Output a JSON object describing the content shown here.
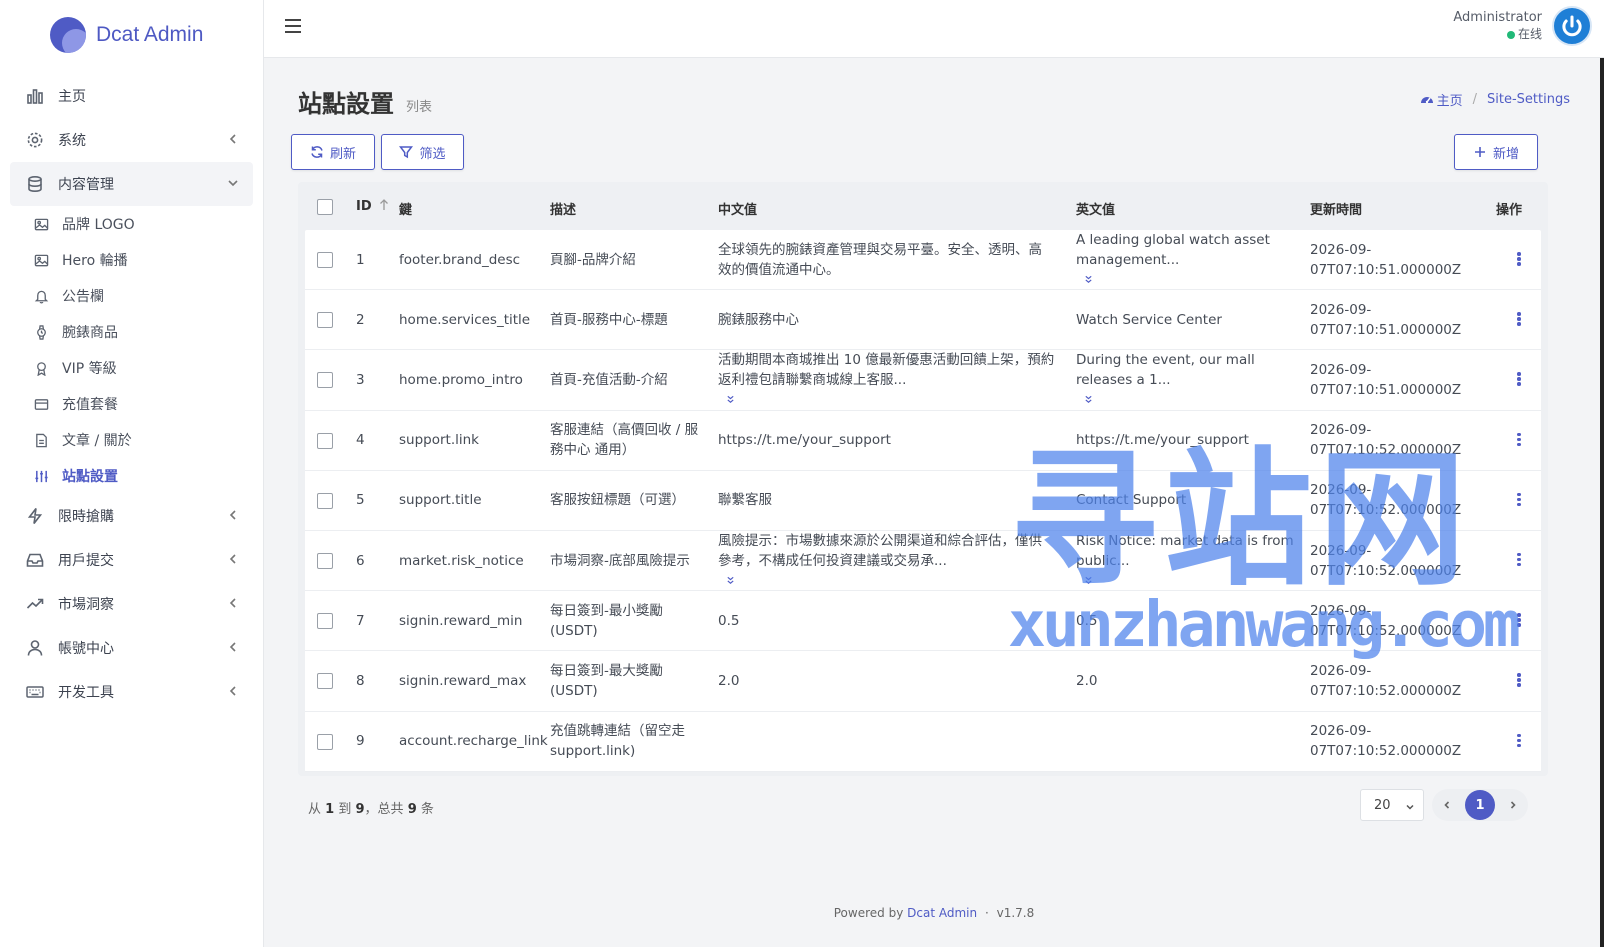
{
  "app": {
    "name": "Dcat Admin"
  },
  "sidebar": {
    "items": [
      {
        "label": "主页",
        "icon": "bar-chart-icon"
      },
      {
        "label": "系统",
        "icon": "gear-icon"
      },
      {
        "label": "内容管理",
        "icon": "database-icon",
        "open": true
      },
      {
        "label": "限時搶購",
        "icon": "lightning-icon"
      },
      {
        "label": "用戶提交",
        "icon": "inbox-icon"
      },
      {
        "label": "市場洞察",
        "icon": "trend-up-icon"
      },
      {
        "label": "帳號中心",
        "icon": "user-icon"
      },
      {
        "label": "开发工具",
        "icon": "keyboard-icon"
      }
    ],
    "content_sub": [
      {
        "label": "品牌 LOGO",
        "icon": "image-icon"
      },
      {
        "label": "Hero 輪播",
        "icon": "image-icon"
      },
      {
        "label": "公告欄",
        "icon": "bell-icon"
      },
      {
        "label": "腕錶商品",
        "icon": "watch-icon"
      },
      {
        "label": "VIP 等級",
        "icon": "award-icon"
      },
      {
        "label": "充值套餐",
        "icon": "credit-card-icon"
      },
      {
        "label": "文章 / 關於",
        "icon": "file-icon"
      },
      {
        "label": "站點設置",
        "icon": "sliders-icon",
        "active": true
      }
    ]
  },
  "header": {
    "user_name": "Administrator",
    "user_status": "在线"
  },
  "page": {
    "title": "站點設置",
    "subtitle": "列表",
    "breadcrumb": {
      "home": "主页",
      "current": "Site-Settings"
    }
  },
  "toolbar": {
    "refresh": "刷新",
    "filter": "筛选",
    "create": "新增"
  },
  "table": {
    "columns": {
      "id": "ID",
      "key": "鍵",
      "desc": "描述",
      "zh": "中文值",
      "en": "英文值",
      "updated": "更新時間",
      "actions": "操作"
    },
    "rows": [
      {
        "id": "1",
        "key": "footer.brand_desc",
        "desc": "頁腳-品牌介紹",
        "zh1": "全球領先的腕錶資產管理與交易平臺。安全、透明、高",
        "zh2": "效的價值流通中心。",
        "en1": "A leading global watch asset",
        "en2": "management...",
        "u1": "2026-09-",
        "u2": "07T07:10:51.000000Z",
        "zh_more": false,
        "en_more": true
      },
      {
        "id": "2",
        "key": "home.services_title",
        "desc": "首頁-服務中心-標題",
        "zh1": "腕錶服務中心",
        "zh2": "",
        "en1": "Watch Service Center",
        "en2": "",
        "u1": "2026-09-",
        "u2": "07T07:10:51.000000Z",
        "zh_more": false,
        "en_more": false
      },
      {
        "id": "3",
        "key": "home.promo_intro",
        "desc": "首頁-充值活動-介紹",
        "zh1": "活動期間本商城推出 10 億最新優惠活動回饋上架，預約",
        "zh2": "返利禮包請聯繫商城線上客服...",
        "en1": "During the event, our mall",
        "en2": "releases a 1...",
        "u1": "2026-09-",
        "u2": "07T07:10:51.000000Z",
        "zh_more": true,
        "en_more": true
      },
      {
        "id": "4",
        "key": "support.link",
        "desc": "客服連結（高價回收 / 服",
        "desc2": "務中心 通用）",
        "zh1": "https://t.me/your_support",
        "zh2": "",
        "en1": "https://t.me/your_support",
        "en2": "",
        "u1": "2026-09-",
        "u2": "07T07:10:52.000000Z",
        "zh_more": false,
        "en_more": false
      },
      {
        "id": "5",
        "key": "support.title",
        "desc": "客服按鈕標題（可選）",
        "zh1": "聯繫客服",
        "zh2": "",
        "en1": "Contact Support",
        "en2": "",
        "u1": "2026-09-",
        "u2": "07T07:10:52.000000Z",
        "zh_more": false,
        "en_more": false
      },
      {
        "id": "6",
        "key": "market.risk_notice",
        "desc": "市場洞察-底部風險提示",
        "zh1": "風險提示：市場數據來源於公開渠道和綜合評估，僅供",
        "zh2": "參考，不構成任何投資建議或交易承...",
        "en1": "Risk Notice: market data is from",
        "en2": "public...",
        "u1": "2026-09-",
        "u2": "07T07:10:52.000000Z",
        "zh_more": true,
        "en_more": true
      },
      {
        "id": "7",
        "key": "signin.reward_min",
        "desc": "每日簽到-最小獎勵",
        "desc2": "(USDT)",
        "zh1": "0.5",
        "zh2": "",
        "en1": "0.5",
        "en2": "",
        "u1": "2026-09-",
        "u2": "07T07:10:52.000000Z",
        "zh_more": false,
        "en_more": false
      },
      {
        "id": "8",
        "key": "signin.reward_max",
        "desc": "每日簽到-最大獎勵",
        "desc2": "(USDT)",
        "zh1": "2.0",
        "zh2": "",
        "en1": "2.0",
        "en2": "",
        "u1": "2026-09-",
        "u2": "07T07:10:52.000000Z",
        "zh_more": false,
        "en_more": false
      },
      {
        "id": "9",
        "key": "account.recharge_link",
        "desc": "充值跳轉連結（留空走",
        "desc2": "support.link)",
        "zh1": "",
        "zh2": "",
        "en1": "",
        "en2": "",
        "u1": "2026-09-",
        "u2": "07T07:10:52.000000Z",
        "zh_more": false,
        "en_more": false
      }
    ]
  },
  "pagination": {
    "from": "1",
    "to": "9",
    "total": "9",
    "per_page": "20",
    "current": "1",
    "text_from": "从",
    "text_to": "到",
    "text_total": "，总共",
    "text_unit": "条"
  },
  "footer": {
    "powered": "Powered by",
    "link": "Dcat Admin",
    "sep": "·",
    "version": "v1.7.8"
  },
  "watermark": {
    "big": "寻站网",
    "small": "xunzhanwang.com"
  },
  "colors": {
    "accent": "#4f5bc5",
    "online": "#21b978",
    "watermark": "#4d82eb"
  }
}
